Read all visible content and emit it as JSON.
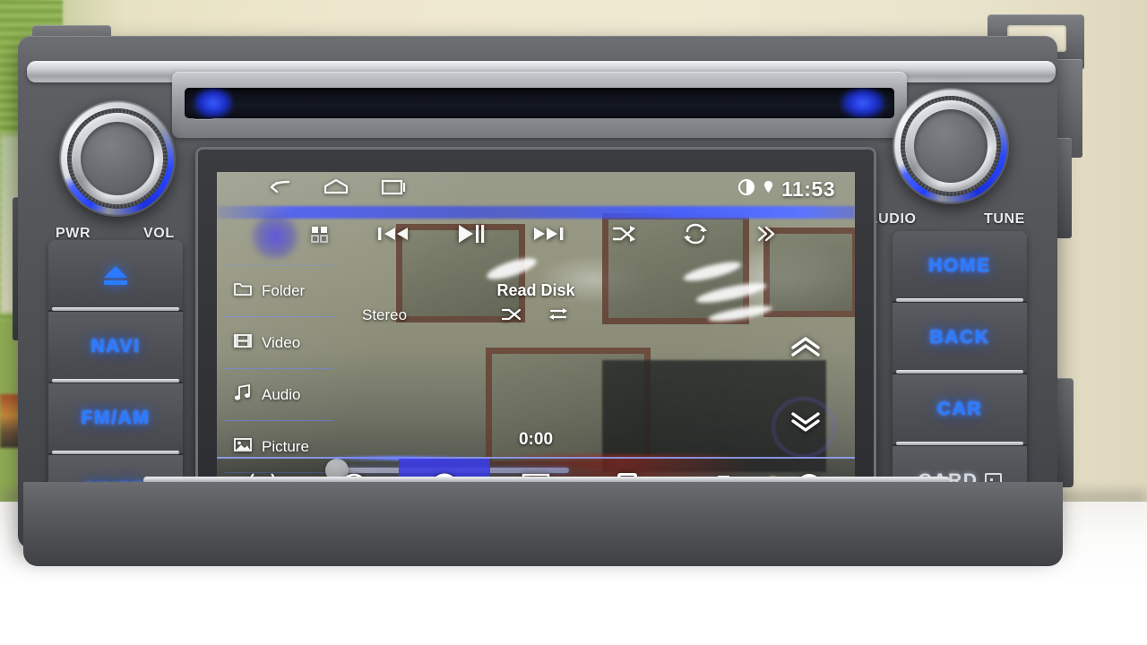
{
  "device": {
    "name": "car-head-unit",
    "brand_glow_color": "#2a7cff",
    "bezel_color": "#56585c"
  },
  "screen": {
    "statusbar": {
      "clock": "11:53",
      "nav_buttons": [
        {
          "name": "back",
          "icon": "back-arrow-icon"
        },
        {
          "name": "home",
          "icon": "home-icon"
        },
        {
          "name": "recents",
          "icon": "recents-icon"
        }
      ],
      "indicators": [
        {
          "name": "contrast",
          "icon": "half-moon-icon"
        },
        {
          "name": "location",
          "icon": "location-pin-icon"
        }
      ]
    },
    "transport": {
      "buttons": [
        {
          "label": "",
          "icon": "list-grid-icon",
          "name": "playlist-button"
        },
        {
          "label": "",
          "icon": "previous-icon",
          "name": "previous-track-button"
        },
        {
          "label": "",
          "icon": "play-pause-icon",
          "name": "play-pause-button"
        },
        {
          "label": "",
          "icon": "next-icon",
          "name": "next-track-button"
        },
        {
          "label": "",
          "icon": "shuffle-icon",
          "name": "shuffle-button"
        },
        {
          "label": "",
          "icon": "repeat-icon",
          "name": "repeat-button"
        },
        {
          "label": "",
          "icon": "double-chevron-right-icon",
          "name": "more-button"
        }
      ]
    },
    "sidebar": {
      "items": [
        {
          "label": "Folder",
          "icon": "folder-icon"
        },
        {
          "label": "Video",
          "icon": "film-icon"
        },
        {
          "label": "Audio",
          "icon": "music-note-icon"
        },
        {
          "label": "Picture",
          "icon": "image-icon"
        }
      ]
    },
    "player": {
      "title": "Read Disk",
      "audio_mode": "Stereo",
      "elapsed_time": "0:00",
      "progress_percent": 0,
      "mode_icons": [
        {
          "name": "shuffle-indicator",
          "icon": "shuffle-icon"
        },
        {
          "name": "repeat-indicator",
          "icon": "repeat-list-icon"
        }
      ]
    },
    "page_nav": [
      {
        "name": "page-up-button",
        "icon": "double-chevron-up-icon"
      },
      {
        "name": "page-down-button",
        "icon": "double-chevron-down-icon"
      }
    ],
    "source_bar": {
      "active": "disc",
      "sources": [
        {
          "key": "radio",
          "icon": "radio-antenna-icon",
          "active": false
        },
        {
          "key": "music",
          "icon": "headphones-icon",
          "active": false
        },
        {
          "key": "disc",
          "icon": "disc-icon",
          "active": true
        },
        {
          "key": "video",
          "icon": "film-strip-icon",
          "active": false
        },
        {
          "key": "ipod",
          "icon": "ipod-icon",
          "active": false
        },
        {
          "key": "aux",
          "icon": "aux-plug-icon",
          "active": false
        },
        {
          "key": "bluetooth",
          "icon": "bluetooth-icon",
          "active": false
        }
      ]
    }
  },
  "hardware": {
    "left_knob_labels": {
      "left": "PWR",
      "right": "VOL"
    },
    "right_knob_labels": {
      "left": "AUDIO",
      "right": "TUNE"
    },
    "left_buttons": [
      {
        "label": "",
        "icon": "eject-icon",
        "name": "eject-button",
        "style": "glow"
      },
      {
        "label": "NAVI",
        "icon": "",
        "name": "navi-button",
        "style": "glow"
      },
      {
        "label": "FM/AM",
        "icon": "",
        "name": "fm-am-button",
        "style": "glow"
      },
      {
        "label": "MUTE",
        "icon": "",
        "name": "mute-button",
        "style": "glow"
      }
    ],
    "right_buttons": [
      {
        "label": "HOME",
        "icon": "",
        "name": "home-button",
        "style": "glow"
      },
      {
        "label": "BACK",
        "icon": "",
        "name": "back-button",
        "style": "glow"
      },
      {
        "label": "CAR",
        "icon": "",
        "name": "car-button",
        "style": "glow"
      },
      {
        "label": "CARD",
        "icon": "card-slot-icon",
        "name": "card-slot",
        "style": "dim"
      }
    ],
    "disc_slot": {
      "name": "disc-slot",
      "label": ""
    }
  }
}
